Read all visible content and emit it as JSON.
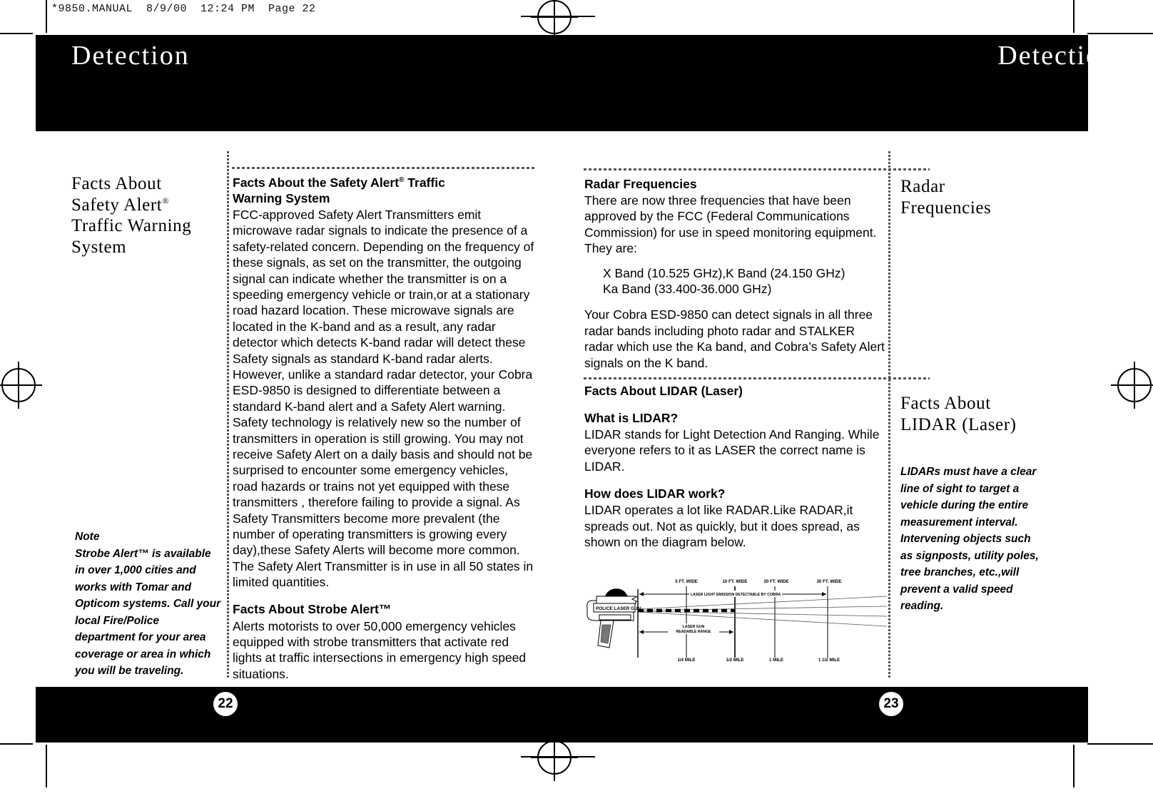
{
  "slug": "*9850.MANUAL  8/9/00  12:24 PM  Page 22",
  "header": {
    "left_title": "Detection",
    "right_title": "Detection"
  },
  "footer": {
    "left_page": "22",
    "right_page": "23"
  },
  "left_page": {
    "sidebar": {
      "heading_line1": "Facts About",
      "heading_line2": "Safety Alert",
      "heading_reg": "®",
      "heading_line3": "Traffic Warning",
      "heading_line4": "System",
      "note_label": "Note",
      "note_text": "Strobe Alert™ is available in over 1,000 cities and works with Tomar and Opticom systems.  Call your local Fire/Police department for your area coverage or area in which you will be traveling."
    },
    "main": {
      "h1_line1": "Facts About the Safety Alert",
      "h1_reg": "®",
      "h1_line1b": " Traffic",
      "h1_line2": "Warning System",
      "p1": "FCC-approved Safety Alert Transmitters emit microwave radar signals to indicate the presence of a safety-related concern. Depending on the frequency of these signals, as set on the transmitter, the outgoing signal can indicate whether the transmitter is on a speeding emergency vehicle or train,or at a stationary road hazard location. These microwave signals are located in the K-band and as a result, any radar detector which detects K-band radar will detect these Safety signals as standard K-band radar alerts. However, unlike a standard radar detector, your Cobra ESD-9850 is designed to differentiate between a standard K-band alert and a Safety Alert warning. Safety technology is relatively new so the number of transmitters in operation is still growing. You may not receive Safety Alert on a daily basis and should not be surprised to encounter some emergency vehicles, road hazards or trains not yet equipped with these transmitters , therefore failing to provide a signal. As Safety Transmitters become more prevalent (the number of operating transmitters is growing every  day),these Safety Alerts will become more common. The Safety Alert Transmitter is in use in all 50 states in limited quantities.",
      "h2": "Facts About Strobe Alert™",
      "p2": "Alerts motorists to over 50,000 emergency vehicles equipped with strobe transmitters that activate red lights at traffic intersections in emergency high speed situations."
    }
  },
  "right_page": {
    "main": {
      "h1": "Radar Frequencies",
      "p1": "There are now three frequencies that have been approved by the FCC (Federal Communications Commission) for use in speed monitoring equipment. They are:",
      "list_line1": "X Band (10.525 GHz),K Band (24.150 GHz)",
      "list_line2": "Ka Band (33.400-36.000 GHz)",
      "p2": "Your Cobra ESD-9850 can detect signals in all three radar bands including photo radar and STALKER radar which use the Ka band,  and Cobra’s Safety Alert signals on the K band.",
      "h2": "Facts About LIDAR (Laser)",
      "h3": "What is LIDAR?",
      "p3": "LIDAR stands for Light Detection And Ranging. While everyone refers to it as LASER the correct name is LIDAR.",
      "h4": "How does LIDAR work?",
      "p4": "LIDAR operates a lot like RADAR.Like RADAR,it spreads out. Not as quickly, but it does spread, as shown on the diagram below."
    },
    "sidebar": {
      "heading1_line1": "Radar",
      "heading1_line2": "Frequencies",
      "heading2_line1": "Facts About",
      "heading2_line2": "LIDAR (Laser)",
      "note_text": "LIDARs must have a clear line of sight to target a vehicle during the entire measurement interval. Intervening objects such as signposts, utility poles, tree branches, etc.,will  prevent a valid speed reading."
    }
  },
  "diagram": {
    "gun_label": "POLICE LASER GUN",
    "emission_label": "LASER LIGHT EMISSION DETECTABLE BY COBRA",
    "readable_label_line1": "LASER GUN",
    "readable_label_line2": "READABLE RANGE",
    "width_labels": [
      "5 FT. WIDE",
      "10 FT. WIDE",
      "20 FT. WIDE",
      "30 FT. WIDE"
    ],
    "distance_labels": [
      "1/4 MILE",
      "1/2 MILE",
      "1 MILE",
      "1 1/2 MILE"
    ]
  }
}
